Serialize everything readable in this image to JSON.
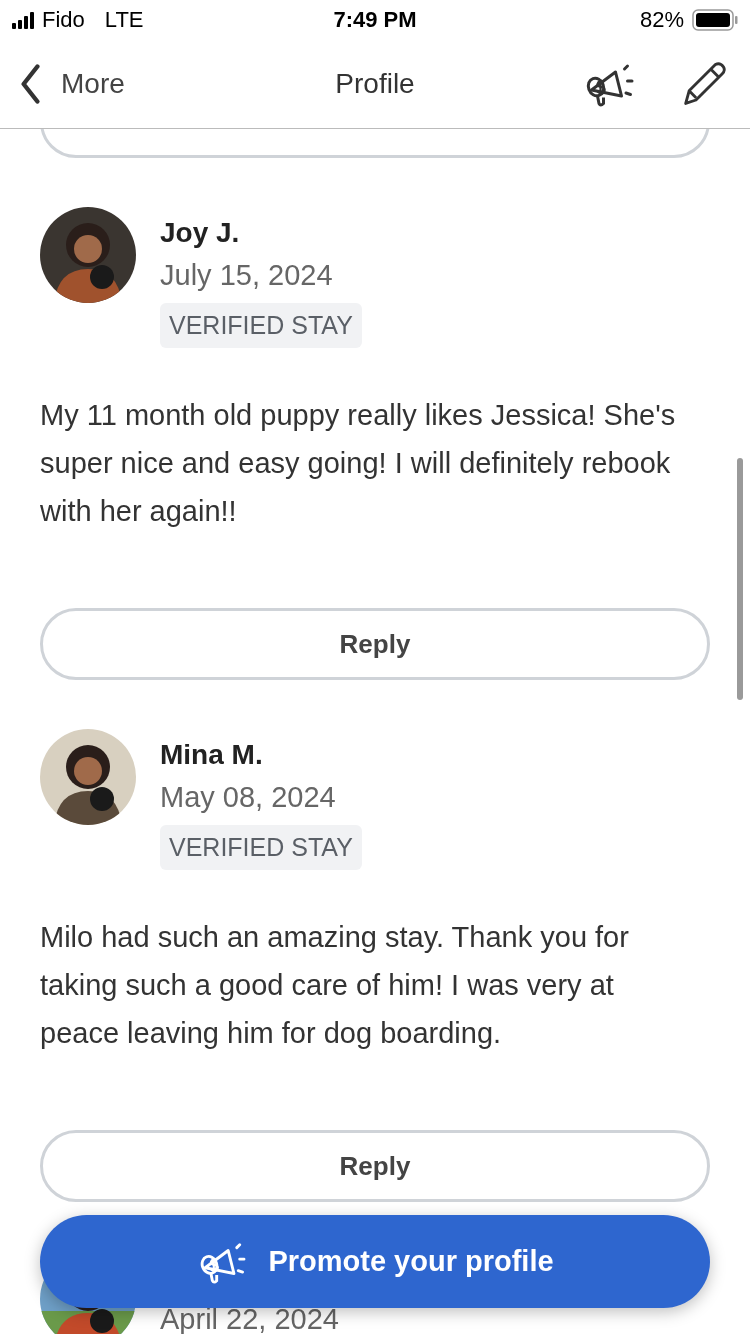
{
  "status_bar": {
    "carrier": "Fido",
    "network": "LTE",
    "time": "7:49 PM",
    "battery": "82%"
  },
  "nav": {
    "back": "More",
    "title": "Profile"
  },
  "reviews": [
    {
      "kind": "partial"
    },
    {
      "kind": "full",
      "name": "Joy J.",
      "date": "July 15, 2024",
      "badge": "VERIFIED STAY",
      "text": "My 11 month old puppy really likes Jessica! She's super nice and easy going! I will definitely rebook with her again!!",
      "reply": "Reply"
    },
    {
      "kind": "full",
      "name": "Mina M.",
      "date": "May 08, 2024",
      "badge": "VERIFIED STAY",
      "text": "Milo had such an amazing stay. Thank you for taking such a good care of him! I was very at peace leaving him for dog boarding.",
      "reply": "Reply"
    },
    {
      "kind": "full",
      "date": "April 22, 2024"
    }
  ],
  "promote_button": "Promote your profile"
}
